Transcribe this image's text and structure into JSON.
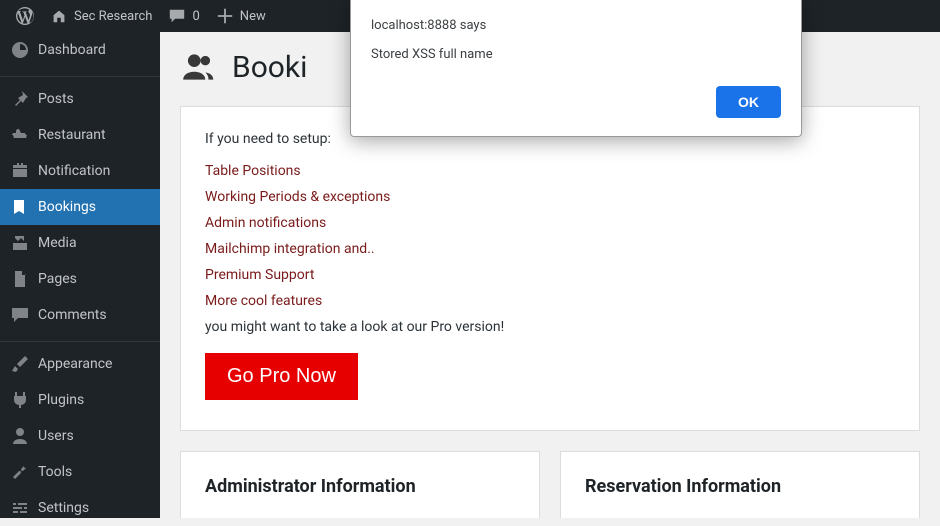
{
  "adminbar": {
    "site_name": "Sec Research",
    "comment_count": "0",
    "new_label": "New"
  },
  "sidebar": {
    "items": [
      {
        "label": "Dashboard"
      },
      {
        "label": "Posts"
      },
      {
        "label": "Restaurant"
      },
      {
        "label": "Notification"
      },
      {
        "label": "Bookings"
      },
      {
        "label": "Media"
      },
      {
        "label": "Pages"
      },
      {
        "label": "Comments"
      },
      {
        "label": "Appearance"
      },
      {
        "label": "Plugins"
      },
      {
        "label": "Users"
      },
      {
        "label": "Tools"
      },
      {
        "label": "Settings"
      }
    ]
  },
  "page": {
    "title": "Booki"
  },
  "setup": {
    "intro": "If you need to setup:",
    "features": [
      "Table Positions",
      "Working Periods & exceptions",
      "Admin notifications",
      "Mailchimp integration and..",
      "Premium Support",
      "More cool features"
    ],
    "outro": "you might want to take a look at our Pro version!",
    "cta_label": "Go Pro Now"
  },
  "cards": {
    "admin_info_title": "Administrator Information",
    "reservation_info_title": "Reservation Information"
  },
  "dialog": {
    "title": "localhost:8888 says",
    "message": "Stored XSS full name",
    "ok_label": "OK"
  }
}
